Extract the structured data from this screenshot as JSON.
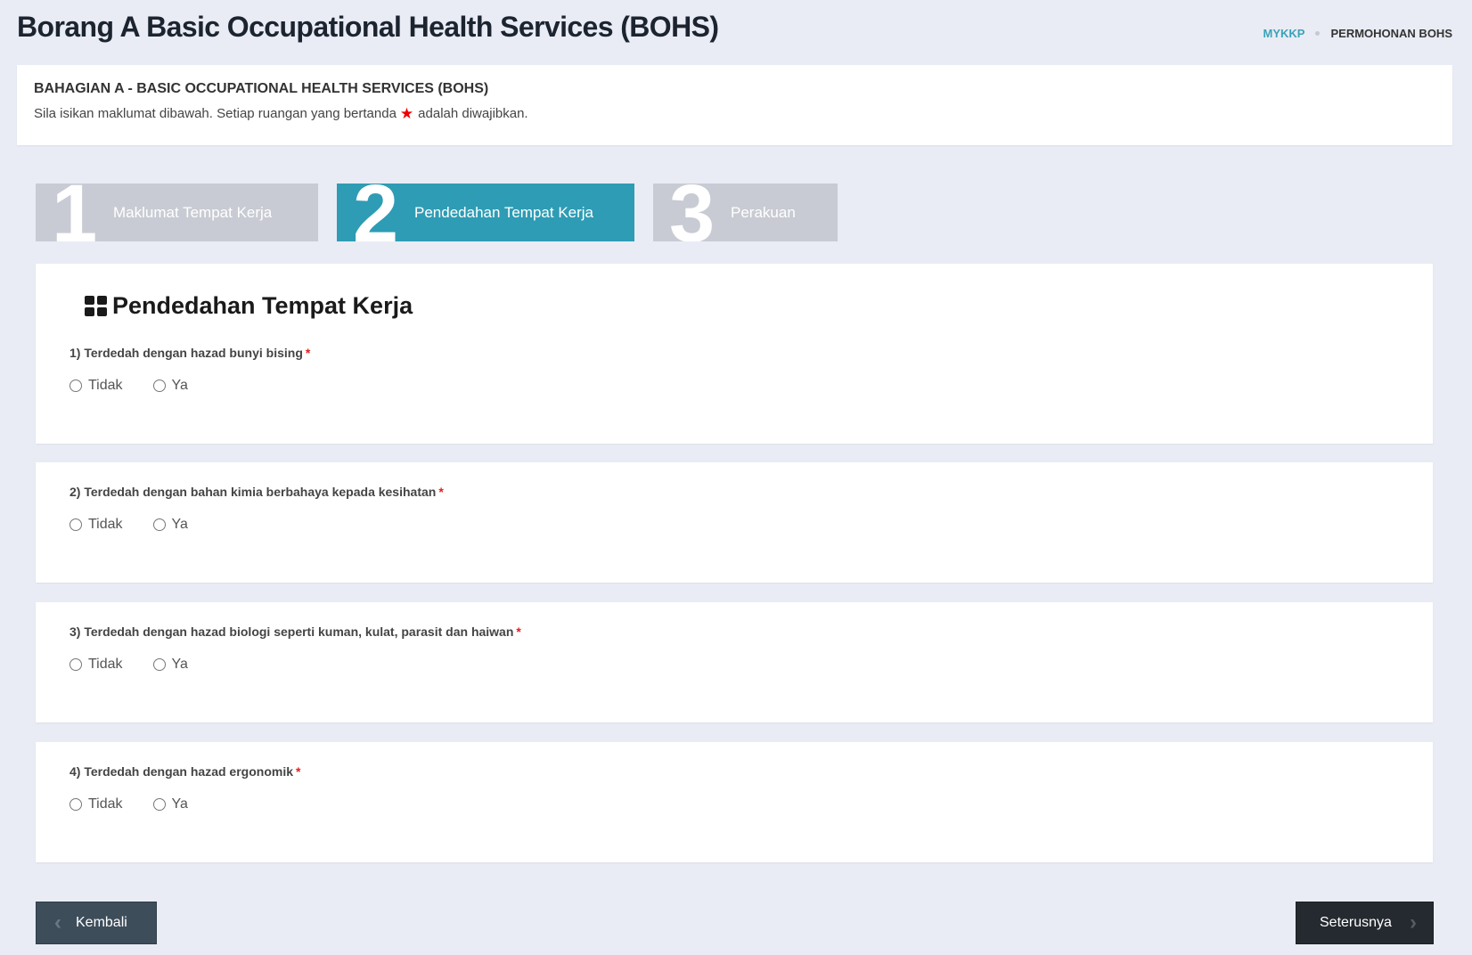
{
  "page": {
    "title": "Borang A Basic Occupational Health Services (BOHS)"
  },
  "breadcrumb": {
    "link": "MYKKP",
    "current": "PERMOHONAN BOHS"
  },
  "section": {
    "title": "BAHAGIAN A - BASIC OCCUPATIONAL HEALTH SERVICES (BOHS)",
    "desc_before": "Sila isikan maklumat dibawah. Setiap ruangan yang bertanda",
    "desc_after": "adalah diwajibkan.",
    "star_icon": "star-icon",
    "star_color": "#e00000"
  },
  "steps": [
    {
      "number": "1",
      "label": "Maklumat Tempat Kerja",
      "state": "inactive"
    },
    {
      "number": "2",
      "label": "Pendedahan Tempat Kerja",
      "state": "active"
    },
    {
      "number": "3",
      "label": "Perakuan",
      "state": "inactive"
    }
  ],
  "form": {
    "title": "Pendedahan Tempat Kerja",
    "title_icon": "th-large-icon",
    "required_mark": "*",
    "questions": [
      {
        "label": "1) Terdedah dengan hazad bunyi bising",
        "options": [
          "Tidak",
          "Ya"
        ],
        "selected": null
      },
      {
        "label": "2) Terdedah dengan bahan kimia berbahaya kepada kesihatan",
        "options": [
          "Tidak",
          "Ya"
        ],
        "selected": null
      },
      {
        "label": "3) Terdedah dengan hazad biologi seperti kuman, kulat, parasit dan haiwan",
        "options": [
          "Tidak",
          "Ya"
        ],
        "selected": null
      },
      {
        "label": "4) Terdedah dengan hazad ergonomik",
        "options": [
          "Tidak",
          "Ya"
        ],
        "selected": null
      }
    ]
  },
  "nav": {
    "back_label": "Kembali",
    "next_label": "Seterusnya",
    "back_icon": "chevron-left-icon",
    "next_icon": "chevron-right-icon"
  },
  "colors": {
    "accent": "#2e9cb4",
    "breadcrumb_link": "#3aa3b8",
    "step_inactive": "#c8cbd3",
    "background": "#e9ecf4"
  }
}
